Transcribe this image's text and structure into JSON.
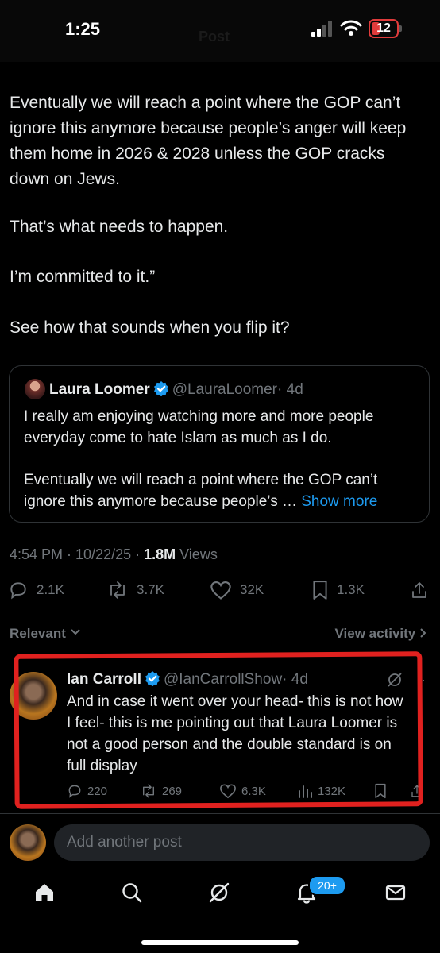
{
  "status_bar": {
    "time": "1:25",
    "battery": "12",
    "ghost_title": "Post"
  },
  "tweet": {
    "paragraphs": [
      "Eventually we will reach a point where the GOP can’t ignore this anymore because people’s anger will keep them home in 2026 & 2028 unless the GOP cracks down on Jews.",
      "That’s what needs to happen.",
      "I’m committed to it.”",
      "See how that sounds when you flip it?"
    ],
    "quote": {
      "name": "Laura Loomer",
      "handle": "@LauraLoomer",
      "time": "· 4d",
      "text1": "I really am enjoying watching more and more people everyday come to hate Islam as much as I do.",
      "text2": "Eventually we will reach a point where the GOP can’t ignore this anymore because people’s …",
      "show_more": "Show more"
    },
    "meta": {
      "timestamp": "4:54 PM · 10/22/25 · ",
      "views_count": "1.8M",
      "views_label": " Views"
    },
    "actions": {
      "replies": "2.1K",
      "reposts": "3.7K",
      "likes": "32K",
      "bookmarks": "1.3K"
    }
  },
  "sort": {
    "label": "Relevant",
    "view_activity": "View activity"
  },
  "reply": {
    "name": "Ian Carroll",
    "handle": "@IanCarrollShow",
    "time": "· 4d",
    "text": "And in case it went over your head- this is not how I feel- this is me pointing out that Laura Loomer is not a good person and the double standard is on full display",
    "actions": {
      "replies": "220",
      "reposts": "269",
      "likes": "6.3K",
      "views": "132K"
    }
  },
  "compose": {
    "placeholder": "Add another post"
  },
  "tabbar": {
    "notifications_badge": "20+"
  },
  "colors": {
    "accent": "#1d9bf0",
    "highlight": "#e0211f",
    "muted": "#71767b"
  }
}
